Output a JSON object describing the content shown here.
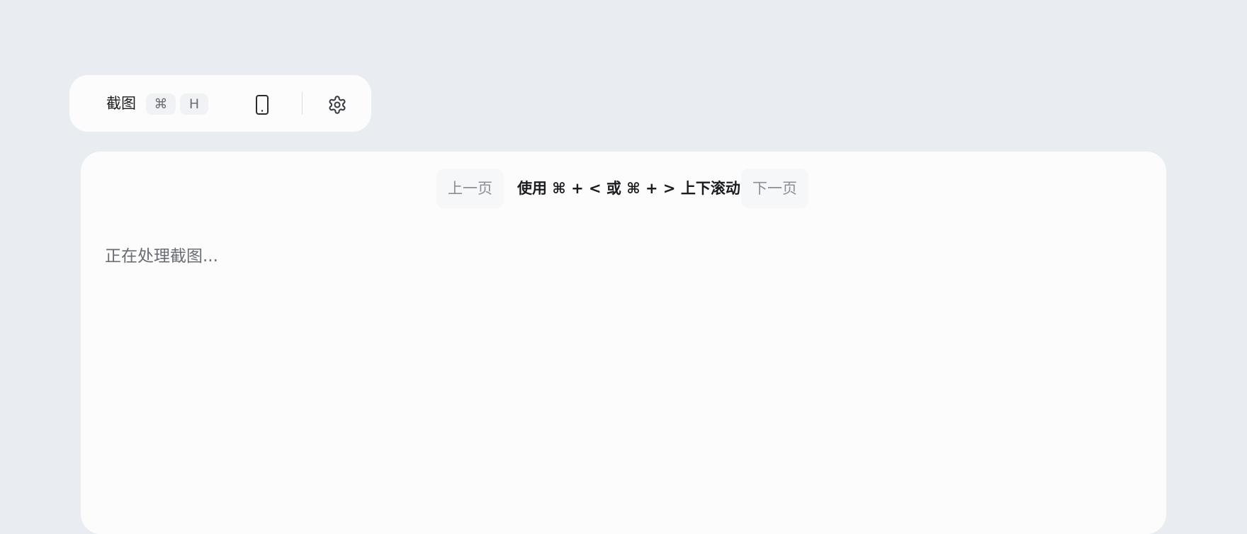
{
  "toolbar": {
    "screenshot_label": "截图",
    "shortcut_keys": [
      "⌘",
      "H"
    ],
    "device_icon": "phone-device-icon",
    "settings_icon": "gear-icon"
  },
  "pager": {
    "prev_label": "上一页",
    "hint": "使用 ⌘ + < 或 ⌘ + > 上下滚动",
    "next_label": "下一页"
  },
  "content": {
    "status_text": "正在处理截图..."
  }
}
